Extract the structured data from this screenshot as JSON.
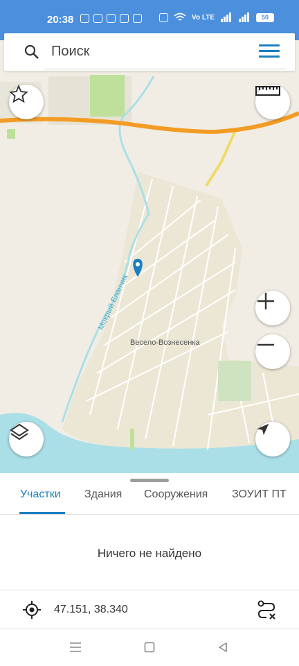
{
  "status": {
    "time": "20:38",
    "battery": "50",
    "network": "Vo LTE"
  },
  "search": {
    "placeholder": "Поиск"
  },
  "map": {
    "place_label": "Весело-Вознесенка",
    "river_label": "Мокрый Еланчик"
  },
  "tabs": [
    {
      "label": "Участки",
      "active": true
    },
    {
      "label": "Здания",
      "active": false
    },
    {
      "label": "Сооружения",
      "active": false
    },
    {
      "label": "ЗОУИТ ПТ",
      "active": false
    }
  ],
  "results": {
    "empty_text": "Ничего не найдено"
  },
  "coords": {
    "value": "47.151, 38.340"
  },
  "colors": {
    "accent": "#1a7fc1",
    "status_bar": "#4b8fdd",
    "road": "#f39c25",
    "water": "#aadfe8"
  },
  "icons": [
    "search-icon",
    "menu-icon",
    "star-icon",
    "ruler-icon",
    "zoom-in-icon",
    "zoom-out-icon",
    "layers-icon",
    "navigate-icon",
    "location-pin-icon",
    "crosshair-icon",
    "route-clear-icon"
  ]
}
